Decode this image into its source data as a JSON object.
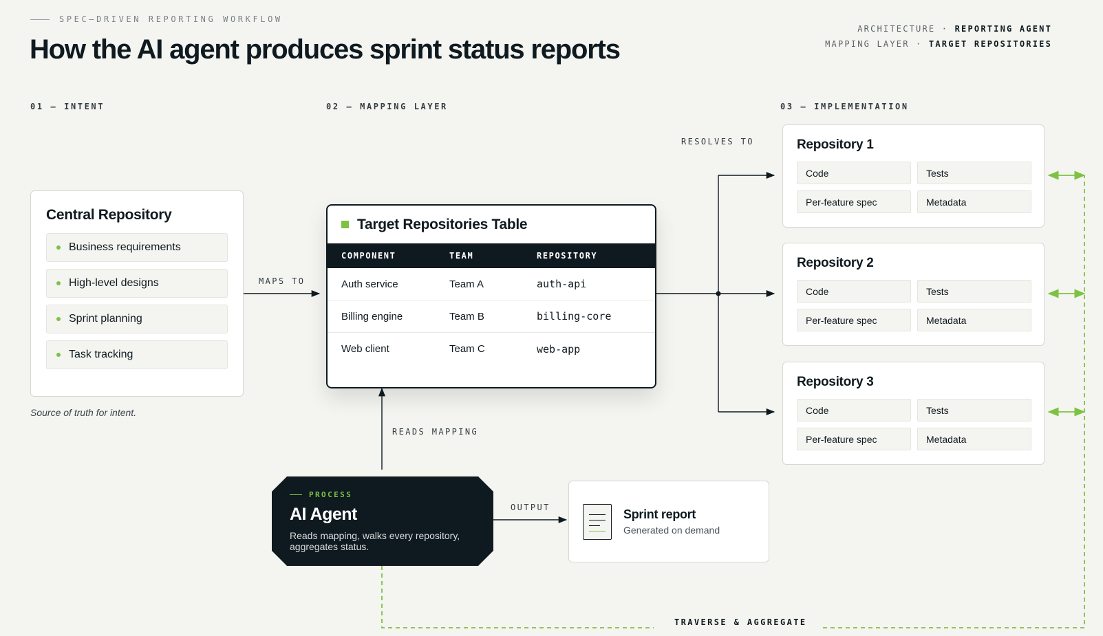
{
  "header": {
    "eyebrow": "SPEC–DRIVEN REPORTING WORKFLOW",
    "title": "How the AI agent produces sprint status reports",
    "meta_line1_prefix": "ARCHITECTURE ·",
    "meta_line1_strong": "REPORTING AGENT",
    "meta_line2_prefix": "MAPPING LAYER ·",
    "meta_line2_strong": "TARGET REPOSITORIES"
  },
  "sections": {
    "intent": "01 — INTENT",
    "mapping": "02 — MAPPING LAYER",
    "implementation": "03 — IMPLEMENTATION"
  },
  "central": {
    "title": "Central Repository",
    "items": [
      "Business requirements",
      "High-level designs",
      "Sprint planning",
      "Task tracking"
    ],
    "caption": "Source of truth for intent."
  },
  "table": {
    "title": "Target Repositories Table",
    "headers": [
      "COMPONENT",
      "TEAM",
      "REPOSITORY"
    ],
    "rows": [
      [
        "Auth service",
        "Team A",
        "auth-api"
      ],
      [
        "Billing engine",
        "Team B",
        "billing-core"
      ],
      [
        "Web client",
        "Team C",
        "web-app"
      ]
    ]
  },
  "repositories": [
    {
      "title": "Repository 1",
      "cells": [
        "Code",
        "Tests",
        "Per-feature spec",
        "Metadata"
      ]
    },
    {
      "title": "Repository 2",
      "cells": [
        "Code",
        "Tests",
        "Per-feature spec",
        "Metadata"
      ]
    },
    {
      "title": "Repository 3",
      "cells": [
        "Code",
        "Tests",
        "Per-feature spec",
        "Metadata"
      ]
    }
  ],
  "agent": {
    "tag": "PROCESS",
    "title": "AI Agent",
    "description": "Reads mapping, walks every repository, aggregates status."
  },
  "report": {
    "title": "Sprint report",
    "subtitle": "Generated on demand"
  },
  "labels": {
    "maps_to": "MAPS TO",
    "resolves_to": "RESOLVES TO",
    "reads_mapping": "READS MAPPING",
    "output": "OUTPUT",
    "traverse": "TRAVERSE & AGGREGATE"
  },
  "colors": {
    "ink": "#0f1a20",
    "accent": "#7dc242",
    "background": "#f4f4f0"
  }
}
